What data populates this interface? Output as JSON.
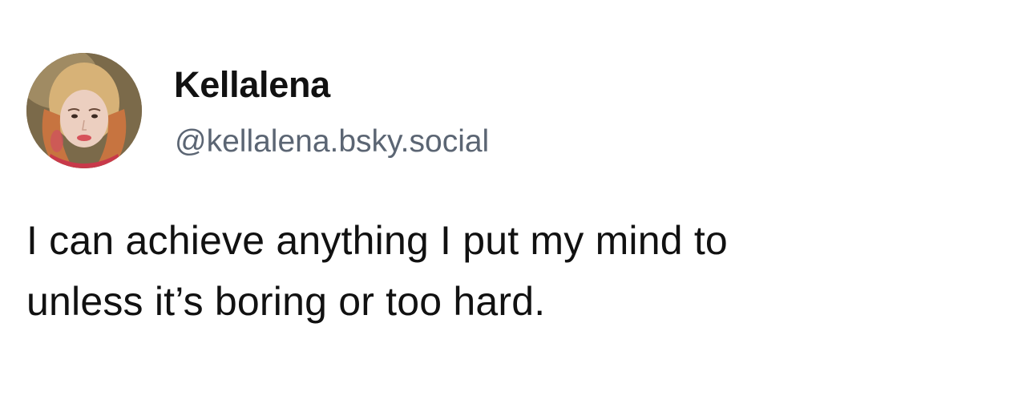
{
  "author": {
    "display_name": "Kellalena",
    "handle": "@kellalena.bsky.social",
    "avatar_icon": "profile-photo"
  },
  "post": {
    "lines": [
      "I can achieve anything I put my mind to",
      "unless it’s boring or too hard."
    ]
  },
  "colors": {
    "background": "#ffffff",
    "text": "#111111",
    "handle": "#5b6573"
  }
}
